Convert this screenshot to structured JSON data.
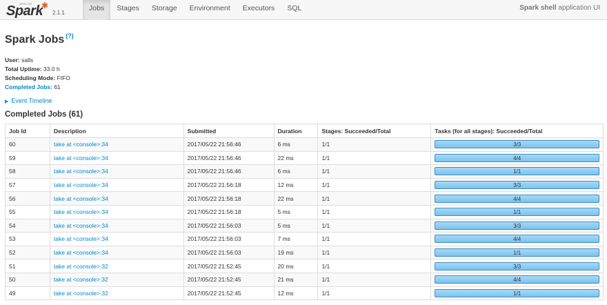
{
  "nav": {
    "logo": {
      "apache": "APACHE",
      "word": "Spark",
      "version": "2.1.1"
    },
    "tabs": [
      {
        "label": "Jobs",
        "active": true
      },
      {
        "label": "Stages",
        "active": false
      },
      {
        "label": "Storage",
        "active": false
      },
      {
        "label": "Environment",
        "active": false
      },
      {
        "label": "Executors",
        "active": false
      },
      {
        "label": "SQL",
        "active": false
      }
    ],
    "app_name": "Spark shell",
    "app_suffix": " application UI"
  },
  "page": {
    "title": "Spark Jobs",
    "help": "(?)",
    "user_label": "User:",
    "user_value": " salls",
    "uptime_label": "Total Uptime:",
    "uptime_value": " 33.0 h",
    "mode_label": "Scheduling Mode:",
    "mode_value": " FIFO",
    "completed_label": "Completed Jobs:",
    "completed_value": " 61",
    "timeline": "Event Timeline",
    "section_title": "Completed Jobs (61)"
  },
  "table": {
    "headers": [
      "Job Id",
      "Description",
      "Submitted",
      "Duration",
      "Stages: Succeeded/Total",
      "Tasks (for all stages): Succeeded/Total"
    ],
    "rows": [
      {
        "id": "60",
        "desc": "take at <console>:34",
        "submitted": "2017/05/22 21:56:46",
        "duration": "6 ms",
        "stages": "1/1",
        "tasks": "3/3",
        "progress": 1.0
      },
      {
        "id": "59",
        "desc": "take at <console>:34",
        "submitted": "2017/05/22 21:56:46",
        "duration": "22 ms",
        "stages": "1/1",
        "tasks": "4/4",
        "progress": 1.0
      },
      {
        "id": "58",
        "desc": "take at <console>:34",
        "submitted": "2017/05/22 21:56:46",
        "duration": "6 ms",
        "stages": "1/1",
        "tasks": "1/1",
        "progress": 1.0
      },
      {
        "id": "57",
        "desc": "take at <console>:34",
        "submitted": "2017/05/22 21:56:18",
        "duration": "12 ms",
        "stages": "1/1",
        "tasks": "3/3",
        "progress": 1.0
      },
      {
        "id": "56",
        "desc": "take at <console>:34",
        "submitted": "2017/05/22 21:56:18",
        "duration": "22 ms",
        "stages": "1/1",
        "tasks": "4/4",
        "progress": 1.0
      },
      {
        "id": "55",
        "desc": "take at <console>:34",
        "submitted": "2017/05/22 21:56:18",
        "duration": "5 ms",
        "stages": "1/1",
        "tasks": "1/1",
        "progress": 1.0
      },
      {
        "id": "54",
        "desc": "take at <console>:34",
        "submitted": "2017/05/22 21:56:03",
        "duration": "5 ms",
        "stages": "1/1",
        "tasks": "3/3",
        "progress": 1.0
      },
      {
        "id": "53",
        "desc": "take at <console>:34",
        "submitted": "2017/05/22 21:56:03",
        "duration": "7 ms",
        "stages": "1/1",
        "tasks": "4/4",
        "progress": 1.0
      },
      {
        "id": "52",
        "desc": "take at <console>:34",
        "submitted": "2017/05/22 21:56:03",
        "duration": "19 ms",
        "stages": "1/1",
        "tasks": "1/1",
        "progress": 1.0
      },
      {
        "id": "51",
        "desc": "take at <console>:32",
        "submitted": "2017/05/22 21:52:45",
        "duration": "20 ms",
        "stages": "1/1",
        "tasks": "3/3",
        "progress": 1.0
      },
      {
        "id": "50",
        "desc": "take at <console>:32",
        "submitted": "2017/05/22 21:52:45",
        "duration": "21 ms",
        "stages": "1/1",
        "tasks": "4/4",
        "progress": 1.0
      },
      {
        "id": "49",
        "desc": "take at <console>:32",
        "submitted": "2017/05/22 21:52:45",
        "duration": "12 ms",
        "stages": "1/1",
        "tasks": "1/1",
        "progress": 1.0
      }
    ]
  },
  "colors": {
    "accent": "#0088cc",
    "bar": "#7cc3ee",
    "spark_star": "#e25a1c"
  }
}
